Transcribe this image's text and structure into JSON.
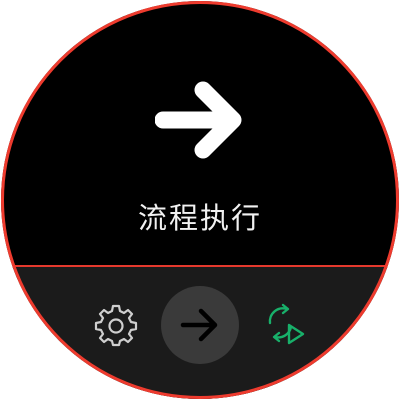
{
  "screen": {
    "title": "流程执行",
    "hero_icon": "arrow-right-icon",
    "accent_color": "#ee3b2e",
    "loop_color": "#18b06a"
  },
  "bottom_bar": {
    "items": [
      {
        "icon": "gear-icon",
        "active": false
      },
      {
        "icon": "arrow-right-icon",
        "active": true
      },
      {
        "icon": "loop-play-icon",
        "active": false
      }
    ]
  }
}
